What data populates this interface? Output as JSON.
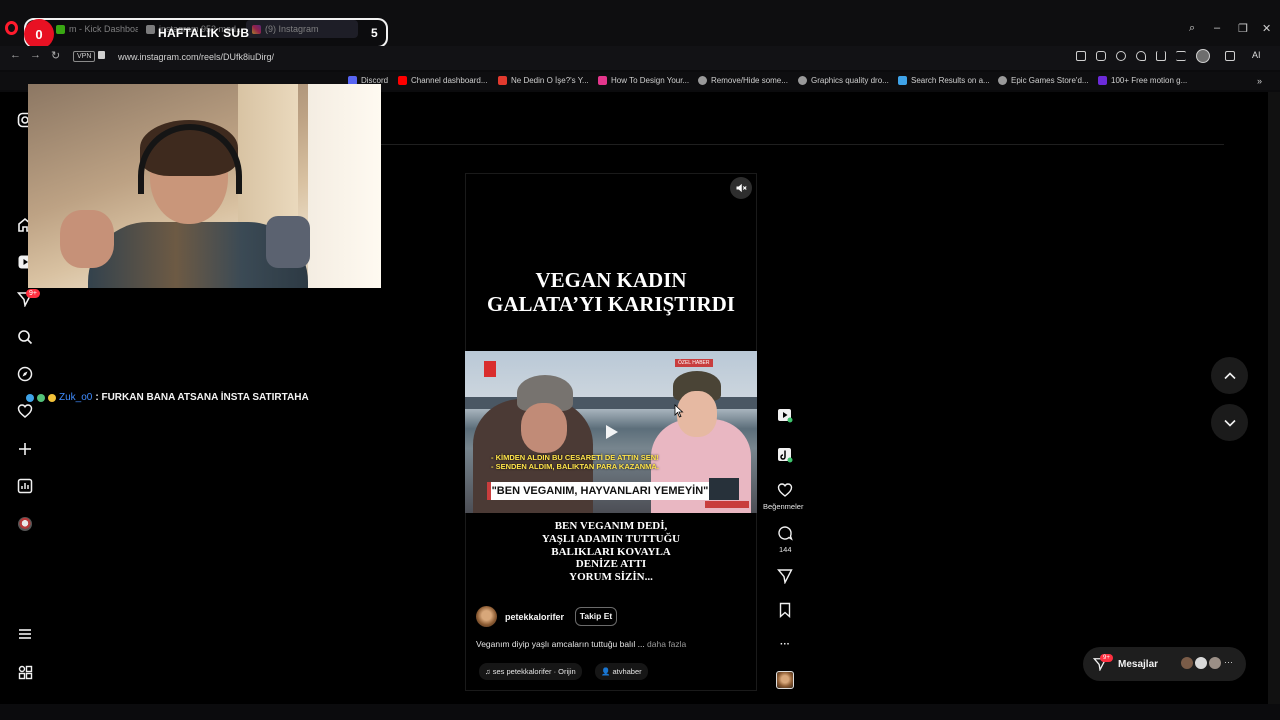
{
  "browser": {
    "tabs": [
      {
        "label": "m - Kick Dashboard"
      },
      {
        "label": "instagram 952 mod..."
      },
      {
        "label": "(9) Instagram"
      }
    ],
    "overlay": {
      "count": "0",
      "title": "HAFTALIK SUB",
      "number": "5"
    },
    "vpn_label": "VPN",
    "url": "www.instagram.com/reels/DUfk8iuDirg/",
    "ai_label": "AI",
    "bookmarks": [
      {
        "label": "Discord"
      },
      {
        "label": "Channel dashboard..."
      },
      {
        "label": "Ne Dedin O İşe?'s Y..."
      },
      {
        "label": "How To Design Your..."
      },
      {
        "label": "Remove/Hide some..."
      },
      {
        "label": "Graphics quality dro..."
      },
      {
        "label": "Search Results on a..."
      },
      {
        "label": "Epic Games Store'd..."
      },
      {
        "label": "100+ Free motion g..."
      }
    ],
    "colors": {
      "opera": "#ff1b2d",
      "accent_blue": "#3f8cff",
      "badge_red": "#ff3040"
    }
  },
  "nav": {
    "notification_badge": "9+",
    "icons": [
      "home-icon",
      "reels-icon",
      "messages-icon",
      "search-icon",
      "explore-icon",
      "notifications-icon",
      "create-icon",
      "dashboard-icon",
      "profile-icon",
      "menu-icon",
      "more-apps-icon"
    ]
  },
  "chat": {
    "user": "Zuk_o0",
    "message": ": FURKAN BANA ATSANA İNSTA SATIRTAHA"
  },
  "reel": {
    "headline_line1": "VEGAN KADIN",
    "headline_line2": "GALATA’YI KARIŞTIRDI",
    "subtitle_line1": "- KİMDEN ALDIN BU CESARETİ DE ATTIN SEN!",
    "subtitle_line2": "- SENDEN ALDIM, BALIKTAN PARA KAZANMA.",
    "banner": "\"BEN VEGANIM, HAYVANLARI YEMEYİN\"",
    "channel_tag": "ÖZEL HABER",
    "caption_lines": [
      "BEN VEGANIM DEDİ,",
      "YAŞLI ADAMIN TUTTUĞU",
      "BALIKLARI  KOVAYLA",
      "DENİZE ATTI",
      "YORUM SİZİN..."
    ],
    "username": "petekkalorifer",
    "follow_label": "Takip Et",
    "description": "Veganım diyip yaşlı amcaların tuttuğu balıl ... ",
    "more_label": "daha fazla",
    "audio_label": "ses  petekkalorifer · Orijin",
    "tag_label": "atvhaber"
  },
  "actions": {
    "likes_label": "Beğenmeler",
    "comments_count": "144",
    "more_label": "···"
  },
  "messages": {
    "label": "Mesajlar",
    "badge": "9+"
  }
}
